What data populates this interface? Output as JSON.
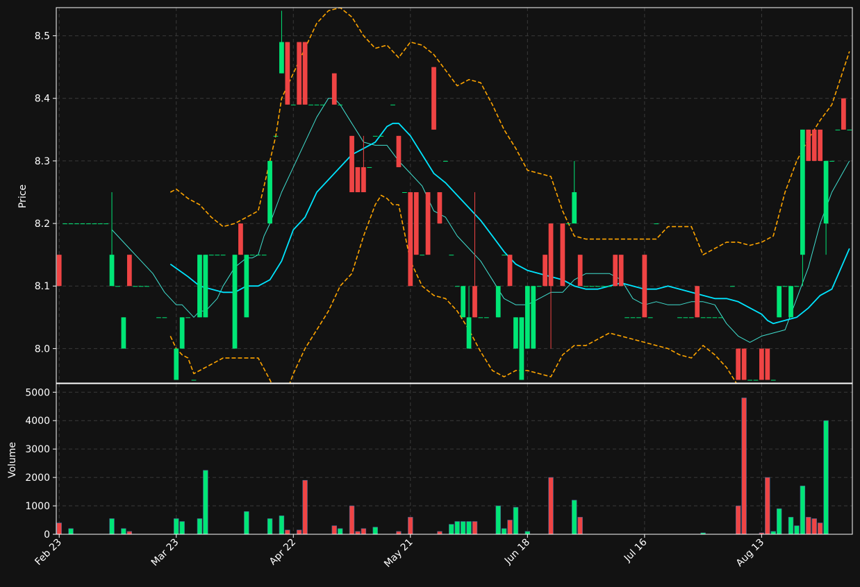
{
  "chart_data": {
    "type": "candlestick",
    "title": "",
    "xlabel": "",
    "ylabel": "Price",
    "volume_label": "Volume",
    "x_tick_labels": [
      "Feb 23",
      "Mar 23",
      "Apr 22",
      "May 21",
      "Jun 18",
      "Jul 16",
      "Aug 13"
    ],
    "x_tick_positions": [
      0,
      20,
      40,
      60,
      80,
      100,
      120
    ],
    "y_ticks": [
      8.0,
      8.1,
      8.2,
      8.3,
      8.4,
      8.5
    ],
    "y_tick_labels": [
      "8.0",
      "8.1",
      "8.2",
      "8.3",
      "8.4",
      "8.5"
    ],
    "volume_ticks": [
      0,
      1000,
      2000,
      3000,
      4000,
      5000
    ],
    "volume_tick_labels": [
      "0",
      "1000",
      "2000",
      "3000",
      "4000",
      "5000"
    ],
    "price_range": [
      7.945,
      8.545
    ],
    "volume_range": [
      0,
      5300
    ],
    "grid": true,
    "colors": {
      "background": "#121212",
      "up": "#00e676",
      "down": "#ef4444",
      "ma_fast": "#40e0d0",
      "ma_slow": "#00e5ff",
      "bands": "#ffa500",
      "grid": "#3a3a3a",
      "text": "#ffffff"
    },
    "candles": [
      [
        0,
        8.15,
        8.15,
        8.1,
        8.1,
        400
      ],
      [
        1,
        8.2,
        8.2,
        8.2,
        8.2,
        0
      ],
      [
        2,
        8.2,
        8.2,
        8.2,
        8.2,
        200
      ],
      [
        3,
        8.2,
        8.2,
        8.2,
        8.2,
        0
      ],
      [
        4,
        8.2,
        8.2,
        8.2,
        8.2,
        0
      ],
      [
        5,
        8.2,
        8.2,
        8.2,
        8.2,
        0
      ],
      [
        6,
        8.2,
        8.2,
        8.2,
        8.2,
        0
      ],
      [
        7,
        8.2,
        8.2,
        8.2,
        8.2,
        0
      ],
      [
        8,
        8.2,
        8.2,
        8.2,
        8.2,
        0
      ],
      [
        9,
        8.1,
        8.25,
        8.1,
        8.15,
        550
      ],
      [
        10,
        8.1,
        8.1,
        8.1,
        8.1,
        0
      ],
      [
        11,
        8.0,
        8.05,
        8.0,
        8.05,
        200
      ],
      [
        12,
        8.15,
        8.15,
        8.1,
        8.1,
        100
      ],
      [
        13,
        8.1,
        8.1,
        8.1,
        8.1,
        0
      ],
      [
        14,
        8.1,
        8.1,
        8.1,
        8.1,
        0
      ],
      [
        15,
        8.1,
        8.1,
        8.1,
        8.1,
        0
      ],
      [
        17,
        8.05,
        8.05,
        8.05,
        8.05,
        0
      ],
      [
        18,
        8.05,
        8.05,
        8.05,
        8.05,
        0
      ],
      [
        20,
        7.95,
        8.0,
        7.95,
        8.0,
        550
      ],
      [
        21,
        8.0,
        8.05,
        8.0,
        8.05,
        450
      ],
      [
        22,
        8.05,
        8.05,
        8.05,
        8.05,
        0
      ],
      [
        23,
        7.95,
        7.95,
        7.95,
        7.95,
        0
      ],
      [
        24,
        8.05,
        8.15,
        8.05,
        8.15,
        550
      ],
      [
        25,
        8.05,
        8.15,
        8.05,
        8.15,
        2250
      ],
      [
        26,
        8.15,
        8.15,
        8.15,
        8.15,
        0
      ],
      [
        27,
        8.15,
        8.15,
        8.15,
        8.15,
        0
      ],
      [
        28,
        8.15,
        8.15,
        8.15,
        8.15,
        0
      ],
      [
        30,
        8.0,
        8.15,
        8.0,
        8.15,
        0
      ],
      [
        31,
        8.2,
        8.2,
        8.15,
        8.15,
        0
      ],
      [
        32,
        8.05,
        8.15,
        8.05,
        8.15,
        800
      ],
      [
        33,
        8.15,
        8.15,
        8.15,
        8.15,
        0
      ],
      [
        34,
        8.15,
        8.15,
        8.15,
        8.15,
        0
      ],
      [
        35,
        8.15,
        8.15,
        8.15,
        8.15,
        0
      ],
      [
        36,
        8.2,
        8.3,
        8.2,
        8.3,
        550
      ],
      [
        37,
        8.34,
        8.34,
        8.34,
        8.34,
        0
      ],
      [
        38,
        8.44,
        8.54,
        8.44,
        8.49,
        650
      ],
      [
        39,
        8.49,
        8.49,
        8.39,
        8.39,
        150
      ],
      [
        40,
        8.39,
        8.39,
        8.39,
        8.39,
        0
      ],
      [
        41,
        8.49,
        8.49,
        8.39,
        8.39,
        150
      ],
      [
        42,
        8.49,
        8.49,
        8.39,
        8.39,
        1900
      ],
      [
        43,
        8.39,
        8.39,
        8.39,
        8.39,
        0
      ],
      [
        44,
        8.39,
        8.39,
        8.39,
        8.39,
        0
      ],
      [
        45,
        8.39,
        8.39,
        8.39,
        8.39,
        0
      ],
      [
        47,
        8.44,
        8.44,
        8.39,
        8.39,
        300
      ],
      [
        48,
        8.39,
        8.39,
        8.39,
        8.39,
        200
      ],
      [
        50,
        8.34,
        8.34,
        8.25,
        8.25,
        1000
      ],
      [
        51,
        8.29,
        8.29,
        8.25,
        8.25,
        100
      ],
      [
        52,
        8.29,
        8.34,
        8.25,
        8.25,
        200
      ],
      [
        53,
        8.29,
        8.29,
        8.29,
        8.29,
        0
      ],
      [
        54,
        8.34,
        8.34,
        8.34,
        8.34,
        250
      ],
      [
        55,
        8.34,
        8.34,
        8.34,
        8.34,
        0
      ],
      [
        57,
        8.39,
        8.39,
        8.39,
        8.39,
        0
      ],
      [
        58,
        8.34,
        8.34,
        8.29,
        8.29,
        100
      ],
      [
        59,
        8.25,
        8.25,
        8.25,
        8.25,
        0
      ],
      [
        60,
        8.25,
        8.25,
        8.1,
        8.1,
        600
      ],
      [
        61,
        8.25,
        8.25,
        8.15,
        8.15,
        0
      ],
      [
        62,
        8.15,
        8.15,
        8.15,
        8.15,
        0
      ],
      [
        63,
        8.25,
        8.25,
        8.15,
        8.15,
        0
      ],
      [
        64,
        8.45,
        8.45,
        8.35,
        8.35,
        0
      ],
      [
        65,
        8.25,
        8.25,
        8.2,
        8.2,
        100
      ],
      [
        66,
        8.3,
        8.3,
        8.3,
        8.3,
        0
      ],
      [
        67,
        8.15,
        8.15,
        8.15,
        8.15,
        350
      ],
      [
        68,
        8.1,
        8.1,
        8.1,
        8.1,
        450
      ],
      [
        69,
        8.05,
        8.1,
        8.05,
        8.1,
        450
      ],
      [
        70,
        8.0,
        8.1,
        8.0,
        8.05,
        450
      ],
      [
        71,
        8.1,
        8.25,
        8.05,
        8.05,
        450
      ],
      [
        72,
        8.05,
        8.05,
        8.05,
        8.05,
        0
      ],
      [
        73,
        8.05,
        8.05,
        8.05,
        8.05,
        0
      ],
      [
        75,
        8.05,
        8.1,
        8.05,
        8.1,
        1000
      ],
      [
        76,
        8.15,
        8.15,
        8.15,
        8.15,
        200
      ],
      [
        77,
        8.15,
        8.15,
        8.1,
        8.1,
        500
      ],
      [
        78,
        8.0,
        8.05,
        8.0,
        8.05,
        950
      ],
      [
        79,
        7.95,
        8.05,
        7.95,
        8.05,
        0
      ],
      [
        80,
        8.0,
        8.1,
        8.0,
        8.1,
        100
      ],
      [
        81,
        8.0,
        8.1,
        8.0,
        8.1,
        0
      ],
      [
        82,
        8.1,
        8.1,
        8.1,
        8.1,
        0
      ],
      [
        83,
        8.15,
        8.15,
        8.1,
        8.1,
        0
      ],
      [
        84,
        8.2,
        8.2,
        8.0,
        8.1,
        2000
      ],
      [
        86,
        8.2,
        8.2,
        8.1,
        8.1,
        0
      ],
      [
        87,
        8.2,
        8.2,
        8.2,
        8.2,
        0
      ],
      [
        88,
        8.2,
        8.3,
        8.2,
        8.25,
        1200
      ],
      [
        89,
        8.15,
        8.15,
        8.1,
        8.1,
        600
      ],
      [
        90,
        8.1,
        8.1,
        8.1,
        8.1,
        0
      ],
      [
        91,
        8.1,
        8.1,
        8.1,
        8.1,
        0
      ],
      [
        92,
        8.1,
        8.1,
        8.1,
        8.1,
        0
      ],
      [
        93,
        8.1,
        8.1,
        8.1,
        8.1,
        0
      ],
      [
        94,
        8.1,
        8.1,
        8.1,
        8.1,
        0
      ],
      [
        95,
        8.15,
        8.15,
        8.1,
        8.1,
        0
      ],
      [
        96,
        8.15,
        8.15,
        8.1,
        8.1,
        0
      ],
      [
        97,
        8.05,
        8.05,
        8.05,
        8.05,
        0
      ],
      [
        98,
        8.05,
        8.05,
        8.05,
        8.05,
        0
      ],
      [
        99,
        8.05,
        8.05,
        8.05,
        8.05,
        0
      ],
      [
        100,
        8.15,
        8.15,
        8.05,
        8.05,
        0
      ],
      [
        101,
        8.05,
        8.05,
        8.05,
        8.05,
        0
      ],
      [
        102,
        8.2,
        8.2,
        8.2,
        8.2,
        0
      ],
      [
        106,
        8.05,
        8.05,
        8.05,
        8.05,
        0
      ],
      [
        107,
        8.05,
        8.05,
        8.05,
        8.05,
        0
      ],
      [
        108,
        8.05,
        8.05,
        8.05,
        8.05,
        0
      ],
      [
        109,
        8.1,
        8.1,
        8.05,
        8.05,
        0
      ],
      [
        110,
        8.05,
        8.05,
        8.05,
        8.05,
        50
      ],
      [
        111,
        8.05,
        8.05,
        8.05,
        8.05,
        0
      ],
      [
        112,
        8.05,
        8.05,
        8.05,
        8.05,
        0
      ],
      [
        113,
        8.05,
        8.05,
        8.05,
        8.05,
        0
      ],
      [
        115,
        8.1,
        8.1,
        8.1,
        8.1,
        0
      ],
      [
        116,
        8.0,
        8.0,
        7.95,
        7.95,
        1000
      ],
      [
        117,
        8.0,
        8.0,
        7.95,
        7.95,
        4800
      ],
      [
        118,
        7.95,
        7.95,
        7.95,
        7.95,
        0
      ],
      [
        119,
        7.95,
        7.95,
        7.95,
        7.95,
        0
      ],
      [
        120,
        8.0,
        8.0,
        7.95,
        7.95,
        50
      ],
      [
        121,
        8.0,
        8.0,
        7.95,
        7.95,
        2000
      ],
      [
        122,
        7.95,
        7.95,
        7.95,
        7.95,
        100
      ],
      [
        123,
        8.05,
        8.1,
        8.05,
        8.1,
        900
      ],
      [
        124,
        8.1,
        8.1,
        8.1,
        8.1,
        0
      ],
      [
        125,
        8.05,
        8.1,
        8.05,
        8.1,
        600
      ],
      [
        126,
        8.1,
        8.1,
        8.1,
        8.1,
        300
      ],
      [
        127,
        8.15,
        8.35,
        8.1,
        8.35,
        1700
      ],
      [
        128,
        8.35,
        8.35,
        8.3,
        8.3,
        600
      ],
      [
        129,
        8.35,
        8.35,
        8.3,
        8.3,
        550
      ],
      [
        130,
        8.35,
        8.35,
        8.3,
        8.3,
        400
      ],
      [
        131,
        8.2,
        8.3,
        8.15,
        8.3,
        4000
      ],
      [
        132,
        8.3,
        8.3,
        8.3,
        8.3,
        0
      ],
      [
        133,
        8.35,
        8.35,
        8.35,
        8.35,
        0
      ],
      [
        134,
        8.4,
        8.4,
        8.35,
        8.35,
        0
      ],
      [
        135,
        8.35,
        8.35,
        8.35,
        8.35,
        0
      ]
    ],
    "ma_fast": {
      "name": "",
      "x": [
        9,
        10,
        12,
        14,
        16,
        18,
        20,
        21,
        22,
        23,
        24,
        25,
        26,
        27,
        28,
        30,
        32,
        33,
        34,
        35,
        36,
        37,
        38,
        40,
        42,
        44,
        46,
        47,
        48,
        50,
        51,
        52,
        54,
        56,
        58,
        60,
        62,
        63,
        64,
        66,
        68,
        70,
        72,
        74,
        76,
        78,
        80,
        82,
        84,
        86,
        88,
        90,
        92,
        94,
        96,
        98,
        100,
        102,
        104,
        106,
        108,
        110,
        112,
        114,
        116,
        118,
        120,
        122,
        124,
        126,
        128,
        130,
        132,
        135
      ],
      "y": [
        8.19,
        8.18,
        8.16,
        8.14,
        8.12,
        8.09,
        8.07,
        8.07,
        8.06,
        8.05,
        8.06,
        8.06,
        8.07,
        8.08,
        8.1,
        8.13,
        8.145,
        8.145,
        8.15,
        8.18,
        8.2,
        8.225,
        8.25,
        8.29,
        8.33,
        8.37,
        8.4,
        8.4,
        8.39,
        8.36,
        8.345,
        8.33,
        8.325,
        8.325,
        8.3,
        8.28,
        8.26,
        8.24,
        8.22,
        8.21,
        8.18,
        8.16,
        8.14,
        8.11,
        8.08,
        8.07,
        8.07,
        8.08,
        8.09,
        8.09,
        8.11,
        8.12,
        8.12,
        8.12,
        8.11,
        8.08,
        8.07,
        8.075,
        8.07,
        8.07,
        8.075,
        8.075,
        8.07,
        8.04,
        8.02,
        8.01,
        8.02,
        8.025,
        8.03,
        8.08,
        8.13,
        8.2,
        8.25,
        8.3
      ]
    },
    "ma_slow": {
      "name": "",
      "x": [
        19,
        22,
        24,
        26,
        28,
        30,
        32,
        33,
        34,
        36,
        38,
        40,
        42,
        44,
        46,
        48,
        50,
        52,
        54,
        56,
        57,
        58,
        60,
        62,
        64,
        66,
        68,
        70,
        72,
        74,
        76,
        78,
        80,
        82,
        84,
        86,
        88,
        90,
        92,
        94,
        96,
        98,
        100,
        102,
        104,
        106,
        108,
        110,
        112,
        114,
        116,
        118,
        120,
        121,
        122,
        124,
        126,
        128,
        130,
        132,
        135
      ],
      "y": [
        8.135,
        8.115,
        8.1,
        8.095,
        8.09,
        8.09,
        8.1,
        8.1,
        8.1,
        8.11,
        8.14,
        8.19,
        8.21,
        8.25,
        8.27,
        8.29,
        8.31,
        8.32,
        8.33,
        8.355,
        8.36,
        8.36,
        8.34,
        8.31,
        8.28,
        8.265,
        8.245,
        8.225,
        8.205,
        8.18,
        8.155,
        8.135,
        8.125,
        8.12,
        8.115,
        8.11,
        8.1,
        8.095,
        8.095,
        8.1,
        8.105,
        8.1,
        8.095,
        8.095,
        8.1,
        8.095,
        8.09,
        8.085,
        8.08,
        8.08,
        8.075,
        8.065,
        8.055,
        8.045,
        8.04,
        8.045,
        8.05,
        8.065,
        8.085,
        8.095,
        8.16
      ]
    },
    "band_upper": {
      "name": "",
      "x": [
        19,
        20,
        22,
        24,
        26,
        28,
        30,
        32,
        33,
        34,
        36,
        37,
        38,
        40,
        42,
        44,
        46,
        48,
        50,
        52,
        54,
        56,
        58,
        60,
        62,
        64,
        66,
        68,
        70,
        72,
        74,
        76,
        78,
        80,
        82,
        84,
        86,
        88,
        90,
        92,
        94,
        96,
        98,
        100,
        102,
        104,
        106,
        108,
        110,
        112,
        114,
        116,
        118,
        120,
        122,
        124,
        126,
        128,
        130,
        132,
        135
      ],
      "y": [
        8.25,
        8.255,
        8.24,
        8.23,
        8.21,
        8.195,
        8.2,
        8.21,
        8.215,
        8.22,
        8.3,
        8.34,
        8.4,
        8.44,
        8.48,
        8.52,
        8.54,
        8.545,
        8.53,
        8.5,
        8.48,
        8.485,
        8.465,
        8.49,
        8.485,
        8.47,
        8.445,
        8.42,
        8.43,
        8.425,
        8.39,
        8.35,
        8.32,
        8.285,
        8.28,
        8.275,
        8.22,
        8.18,
        8.175,
        8.175,
        8.175,
        8.175,
        8.175,
        8.175,
        8.175,
        8.195,
        8.195,
        8.195,
        8.15,
        8.16,
        8.17,
        8.17,
        8.165,
        8.17,
        8.18,
        8.25,
        8.3,
        8.335,
        8.365,
        8.39,
        8.475
      ]
    },
    "band_lower": {
      "name": "",
      "x": [
        19,
        20,
        21,
        22,
        23,
        24,
        26,
        28,
        30,
        32,
        33,
        34,
        36,
        38,
        40,
        42,
        44,
        46,
        48,
        50,
        52,
        54,
        55,
        56,
        57,
        58,
        60,
        62,
        64,
        66,
        68,
        70,
        72,
        74,
        76,
        78,
        80,
        82,
        84,
        86,
        88,
        90,
        92,
        94,
        96,
        98,
        100,
        102,
        104,
        106,
        108,
        110,
        112,
        114,
        116,
        118,
        120,
        122
      ],
      "y": [
        8.02,
        8.0,
        7.99,
        7.985,
        7.96,
        7.965,
        7.975,
        7.985,
        7.985,
        7.985,
        7.985,
        7.985,
        7.95,
        7.91,
        7.96,
        8.0,
        8.03,
        8.06,
        8.1,
        8.12,
        8.18,
        8.23,
        8.245,
        8.24,
        8.23,
        8.23,
        8.14,
        8.1,
        8.085,
        8.08,
        8.06,
        8.03,
        7.995,
        7.965,
        7.955,
        7.965,
        7.965,
        7.96,
        7.955,
        7.99,
        8.005,
        8.005,
        8.015,
        8.025,
        8.02,
        8.015,
        8.01,
        8.005,
        8.0,
        7.99,
        7.985,
        8.005,
        7.99,
        7.97,
        7.94,
        7.92,
        7.9,
        7.89
      ]
    }
  }
}
